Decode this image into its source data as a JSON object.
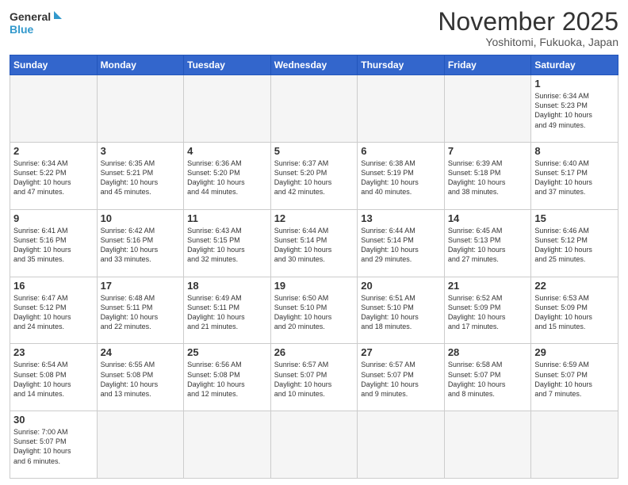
{
  "logo": {
    "line1": "General",
    "line2": "Blue"
  },
  "title": "November 2025",
  "subtitle": "Yoshitomi, Fukuoka, Japan",
  "weekdays": [
    "Sunday",
    "Monday",
    "Tuesday",
    "Wednesday",
    "Thursday",
    "Friday",
    "Saturday"
  ],
  "weeks": [
    [
      {
        "day": "",
        "info": ""
      },
      {
        "day": "",
        "info": ""
      },
      {
        "day": "",
        "info": ""
      },
      {
        "day": "",
        "info": ""
      },
      {
        "day": "",
        "info": ""
      },
      {
        "day": "",
        "info": ""
      },
      {
        "day": "1",
        "info": "Sunrise: 6:34 AM\nSunset: 5:23 PM\nDaylight: 10 hours\nand 49 minutes."
      }
    ],
    [
      {
        "day": "2",
        "info": "Sunrise: 6:34 AM\nSunset: 5:22 PM\nDaylight: 10 hours\nand 47 minutes."
      },
      {
        "day": "3",
        "info": "Sunrise: 6:35 AM\nSunset: 5:21 PM\nDaylight: 10 hours\nand 45 minutes."
      },
      {
        "day": "4",
        "info": "Sunrise: 6:36 AM\nSunset: 5:20 PM\nDaylight: 10 hours\nand 44 minutes."
      },
      {
        "day": "5",
        "info": "Sunrise: 6:37 AM\nSunset: 5:20 PM\nDaylight: 10 hours\nand 42 minutes."
      },
      {
        "day": "6",
        "info": "Sunrise: 6:38 AM\nSunset: 5:19 PM\nDaylight: 10 hours\nand 40 minutes."
      },
      {
        "day": "7",
        "info": "Sunrise: 6:39 AM\nSunset: 5:18 PM\nDaylight: 10 hours\nand 38 minutes."
      },
      {
        "day": "8",
        "info": "Sunrise: 6:40 AM\nSunset: 5:17 PM\nDaylight: 10 hours\nand 37 minutes."
      }
    ],
    [
      {
        "day": "9",
        "info": "Sunrise: 6:41 AM\nSunset: 5:16 PM\nDaylight: 10 hours\nand 35 minutes."
      },
      {
        "day": "10",
        "info": "Sunrise: 6:42 AM\nSunset: 5:16 PM\nDaylight: 10 hours\nand 33 minutes."
      },
      {
        "day": "11",
        "info": "Sunrise: 6:43 AM\nSunset: 5:15 PM\nDaylight: 10 hours\nand 32 minutes."
      },
      {
        "day": "12",
        "info": "Sunrise: 6:44 AM\nSunset: 5:14 PM\nDaylight: 10 hours\nand 30 minutes."
      },
      {
        "day": "13",
        "info": "Sunrise: 6:44 AM\nSunset: 5:14 PM\nDaylight: 10 hours\nand 29 minutes."
      },
      {
        "day": "14",
        "info": "Sunrise: 6:45 AM\nSunset: 5:13 PM\nDaylight: 10 hours\nand 27 minutes."
      },
      {
        "day": "15",
        "info": "Sunrise: 6:46 AM\nSunset: 5:12 PM\nDaylight: 10 hours\nand 25 minutes."
      }
    ],
    [
      {
        "day": "16",
        "info": "Sunrise: 6:47 AM\nSunset: 5:12 PM\nDaylight: 10 hours\nand 24 minutes."
      },
      {
        "day": "17",
        "info": "Sunrise: 6:48 AM\nSunset: 5:11 PM\nDaylight: 10 hours\nand 22 minutes."
      },
      {
        "day": "18",
        "info": "Sunrise: 6:49 AM\nSunset: 5:11 PM\nDaylight: 10 hours\nand 21 minutes."
      },
      {
        "day": "19",
        "info": "Sunrise: 6:50 AM\nSunset: 5:10 PM\nDaylight: 10 hours\nand 20 minutes."
      },
      {
        "day": "20",
        "info": "Sunrise: 6:51 AM\nSunset: 5:10 PM\nDaylight: 10 hours\nand 18 minutes."
      },
      {
        "day": "21",
        "info": "Sunrise: 6:52 AM\nSunset: 5:09 PM\nDaylight: 10 hours\nand 17 minutes."
      },
      {
        "day": "22",
        "info": "Sunrise: 6:53 AM\nSunset: 5:09 PM\nDaylight: 10 hours\nand 15 minutes."
      }
    ],
    [
      {
        "day": "23",
        "info": "Sunrise: 6:54 AM\nSunset: 5:08 PM\nDaylight: 10 hours\nand 14 minutes."
      },
      {
        "day": "24",
        "info": "Sunrise: 6:55 AM\nSunset: 5:08 PM\nDaylight: 10 hours\nand 13 minutes."
      },
      {
        "day": "25",
        "info": "Sunrise: 6:56 AM\nSunset: 5:08 PM\nDaylight: 10 hours\nand 12 minutes."
      },
      {
        "day": "26",
        "info": "Sunrise: 6:57 AM\nSunset: 5:07 PM\nDaylight: 10 hours\nand 10 minutes."
      },
      {
        "day": "27",
        "info": "Sunrise: 6:57 AM\nSunset: 5:07 PM\nDaylight: 10 hours\nand 9 minutes."
      },
      {
        "day": "28",
        "info": "Sunrise: 6:58 AM\nSunset: 5:07 PM\nDaylight: 10 hours\nand 8 minutes."
      },
      {
        "day": "29",
        "info": "Sunrise: 6:59 AM\nSunset: 5:07 PM\nDaylight: 10 hours\nand 7 minutes."
      }
    ],
    [
      {
        "day": "30",
        "info": "Sunrise: 7:00 AM\nSunset: 5:07 PM\nDaylight: 10 hours\nand 6 minutes."
      },
      {
        "day": "",
        "info": ""
      },
      {
        "day": "",
        "info": ""
      },
      {
        "day": "",
        "info": ""
      },
      {
        "day": "",
        "info": ""
      },
      {
        "day": "",
        "info": ""
      },
      {
        "day": "",
        "info": ""
      }
    ]
  ]
}
